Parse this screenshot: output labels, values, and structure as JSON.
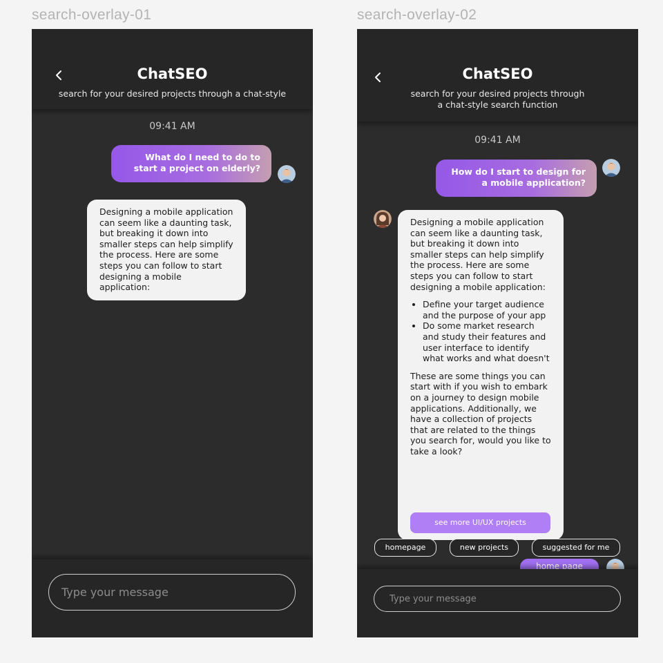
{
  "frames": [
    {
      "label": "search-overlay-01",
      "title": "ChatSEO",
      "subtitle": "search for your desired projects through a chat-style",
      "time": "09:41 AM",
      "user_message": "What do I need to do to start a project on elderly?",
      "bot_message": "Designing a mobile application can seem like a daunting task, but breaking it down into smaller steps can help simplify the process. Here are some steps you can follow to start designing a mobile application:",
      "input_placeholder": "Type your message"
    },
    {
      "label": "search-overlay-02",
      "title": "ChatSEO",
      "subtitle": "search for your desired projects through a chat-style search function",
      "time": "09:41 AM",
      "user_message": "How do I start to design for a mobile application?",
      "bot_intro": "Designing a mobile application can seem like a daunting task, but breaking it down into smaller steps can help simplify the process. Here are some steps you can follow to start designing a mobile application:",
      "bot_bullets": [
        "Define your target audience and the purpose of your app",
        "Do some market research and study their features and user interface to identify what works and what doesn't"
      ],
      "bot_outro": "These are some things you can start with if you wish to embark on a journey to design mobile applications. Additionally, we have a collection of projects that are related to the things you search for, would you like to take a look?",
      "cta_label": "see more UI/UX projects",
      "quick_replies": [
        "homepage",
        "new projects",
        "suggested for me"
      ],
      "peek_message": "home page",
      "input_placeholder": "Type your message"
    }
  ],
  "icons": {
    "back": "chevron-left-icon",
    "user_avatar": "user-avatar",
    "bot_avatar": "bot-avatar"
  },
  "colors": {
    "background": "#f4f4f4",
    "frame": "#2c2c2c",
    "header": "#262626",
    "accent": "#a070f0",
    "bubble_light": "#f2f2f2"
  }
}
